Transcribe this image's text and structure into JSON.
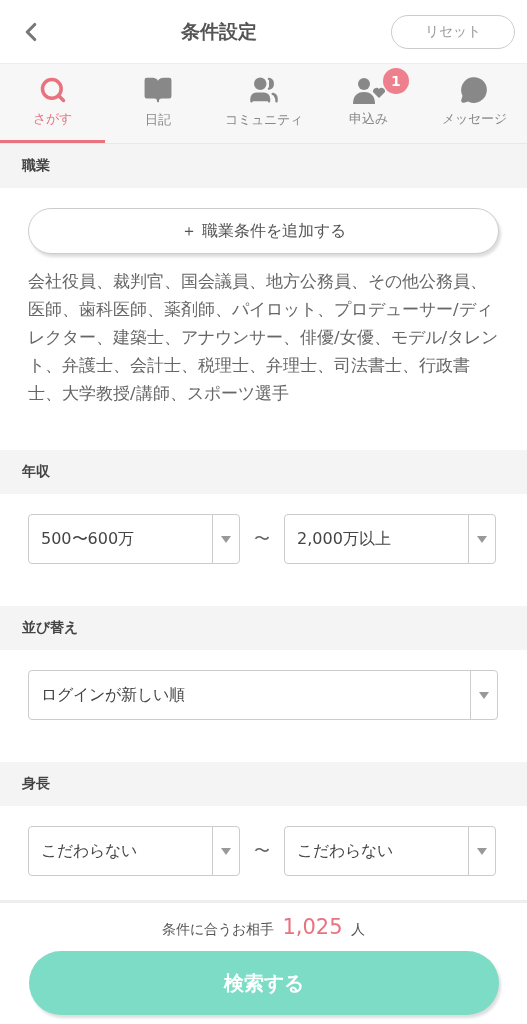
{
  "header": {
    "title": "条件設定",
    "reset": "リセット"
  },
  "tabs": [
    {
      "kind": "search",
      "label": "さがす",
      "selected": true
    },
    {
      "kind": "diary",
      "label": "日記",
      "selected": false
    },
    {
      "kind": "community",
      "label": "コミュニティ",
      "selected": false
    },
    {
      "kind": "requests",
      "label": "申込み",
      "selected": false,
      "badge": "1"
    },
    {
      "kind": "messages",
      "label": "メッセージ",
      "selected": false
    }
  ],
  "sections": [
    {
      "kind": "jobs",
      "title": "職業",
      "add_button": "＋ 職業条件を追加する",
      "text": "会社役員、裁判官、国会議員、地方公務員、その他公務員、医師、歯科医師、薬剤師、パイロット、プロデューサー/ディレクター、建築士、アナウンサー、俳優/女優、モデル/タレント、弁護士、会計士、税理士、弁理士、司法書士、行政書士、大学教授/講師、スポーツ選手"
    },
    {
      "kind": "range",
      "title": "年収",
      "from": "500〜600万",
      "separator": "〜",
      "to": "2,000万以上"
    },
    {
      "kind": "select",
      "title": "並び替え",
      "value": "ログインが新しい順"
    },
    {
      "kind": "range",
      "title": "身長",
      "from": "こだわらない",
      "separator": "〜",
      "to": "こだわらない"
    }
  ],
  "footer": {
    "prefix": "条件に合うお相手",
    "count": "1,025",
    "suffix": "人",
    "button": "検索する"
  }
}
